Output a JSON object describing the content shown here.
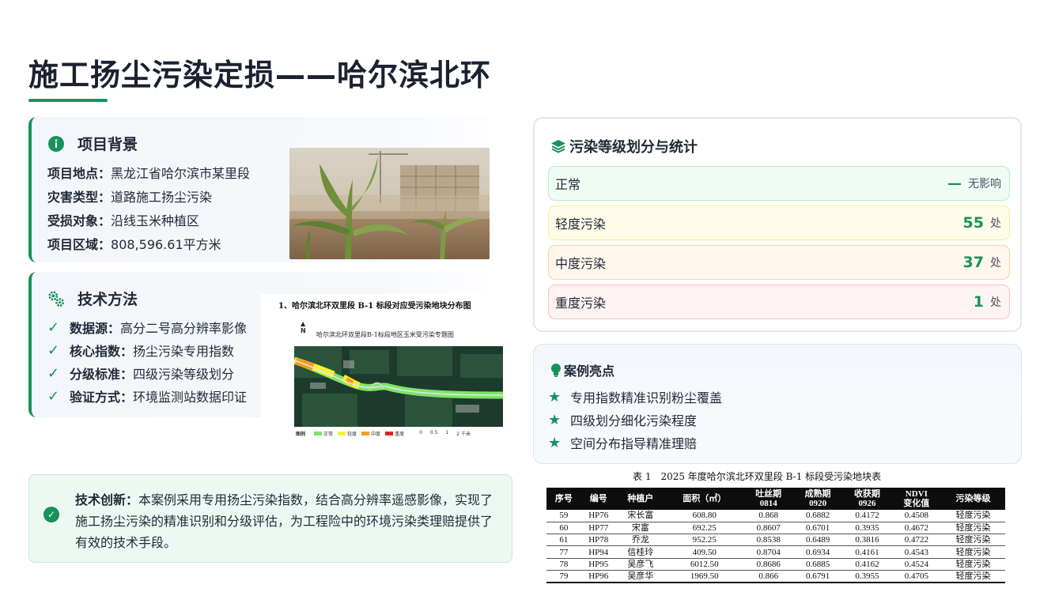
{
  "title": "施工扬尘污染定损——哈尔滨北环",
  "background": {
    "heading": "项目背景",
    "items": [
      {
        "key": "项目地点：",
        "value": "黑龙江省哈尔滨市某里段"
      },
      {
        "key": "灾害类型：",
        "value": "道路施工扬尘污染"
      },
      {
        "key": "受损对象：",
        "value": "沿线玉米种植区"
      },
      {
        "key": "项目区域：",
        "value": "808,596.61平方米"
      }
    ]
  },
  "tech": {
    "heading": "技术方法",
    "items": [
      {
        "key": "数据源：",
        "value": "高分二号高分辨率影像"
      },
      {
        "key": "核心指数：",
        "value": "扬尘污染专用指数"
      },
      {
        "key": "分级标准：",
        "value": "四级污染等级划分"
      },
      {
        "key": "验证方式：",
        "value": "环境监测站数据印证"
      }
    ]
  },
  "map": {
    "caption": "1、哈尔滨北环双里段 B-1 标段对应受污染地块分布图",
    "subtitle": "哈尔滨北环双里段B-1标段地区玉米受污染专题图",
    "north": "N",
    "legend_title": "图例",
    "legend": [
      {
        "label": "正常",
        "color": "#7fe36b"
      },
      {
        "label": "轻度",
        "color": "#f4f136"
      },
      {
        "label": "中度",
        "color": "#f59a1c"
      },
      {
        "label": "重度",
        "color": "#e52020"
      }
    ],
    "scale": [
      "0",
      "0.5",
      "1",
      "2 千米"
    ]
  },
  "innovation": {
    "label": "技术创新：",
    "text": "本案例采用专用扬尘污染指数，结合高分辨率遥感影像，实现了施工扬尘污染的精准识别和分级评估，为工程险中的环境污染类理赔提供了有效的技术手段。"
  },
  "grading": {
    "heading": "污染等级划分与统计",
    "rows": [
      {
        "label": "正常",
        "dash": "—",
        "value": "无影响",
        "bg": "#f0fbf4",
        "border": "#b9ebcb"
      },
      {
        "label": "轻度污染",
        "count": "55",
        "unit": "处",
        "bg": "#fffce8",
        "border": "#f7ec9c"
      },
      {
        "label": "中度污染",
        "count": "37",
        "unit": "处",
        "bg": "#fff6ec",
        "border": "#fad1a6"
      },
      {
        "label": "重度污染",
        "count": "1",
        "unit": "处",
        "bg": "#fff2f2",
        "border": "#f6c3c3"
      }
    ]
  },
  "highlights": {
    "heading": "案例亮点",
    "items": [
      "专用指数精准识别粉尘覆盖",
      "四级划分细化污染程度",
      "空间分布指导精准理赔"
    ]
  },
  "table": {
    "caption": "表 1　2025 年度哈尔滨北环双里段 B-1 标段受污染地块表",
    "headers": [
      "序号",
      "编号",
      "种植户",
      "面积（㎡）",
      "吐丝期\n0814",
      "成熟期\n0920",
      "收获期\n0926",
      "NDVI\n变化值",
      "污染等级"
    ],
    "rows": [
      [
        "59",
        "HP76",
        "宋长富",
        "608.80",
        "0.868",
        "0.6882",
        "0.4172",
        "0.4508",
        "轻度污染"
      ],
      [
        "60",
        "HP77",
        "宋富",
        "692.25",
        "0.8607",
        "0.6701",
        "0.3935",
        "0.4672",
        "轻度污染"
      ],
      [
        "61",
        "HP78",
        "乔龙",
        "952.25",
        "0.8538",
        "0.6489",
        "0.3816",
        "0.4722",
        "轻度污染"
      ],
      [
        "77",
        "HP94",
        "信桂玲",
        "409.50",
        "0.8704",
        "0.6934",
        "0.4161",
        "0.4543",
        "轻度污染"
      ],
      [
        "78",
        "HP95",
        "吴彦飞",
        "6012.50",
        "0.8686",
        "0.6885",
        "0.4162",
        "0.4524",
        "轻度污染"
      ],
      [
        "79",
        "HP96",
        "吴彦华",
        "1969.50",
        "0.866",
        "0.6791",
        "0.3955",
        "0.4705",
        "轻度污染"
      ]
    ]
  },
  "colors": {
    "accent": "#17935a"
  }
}
